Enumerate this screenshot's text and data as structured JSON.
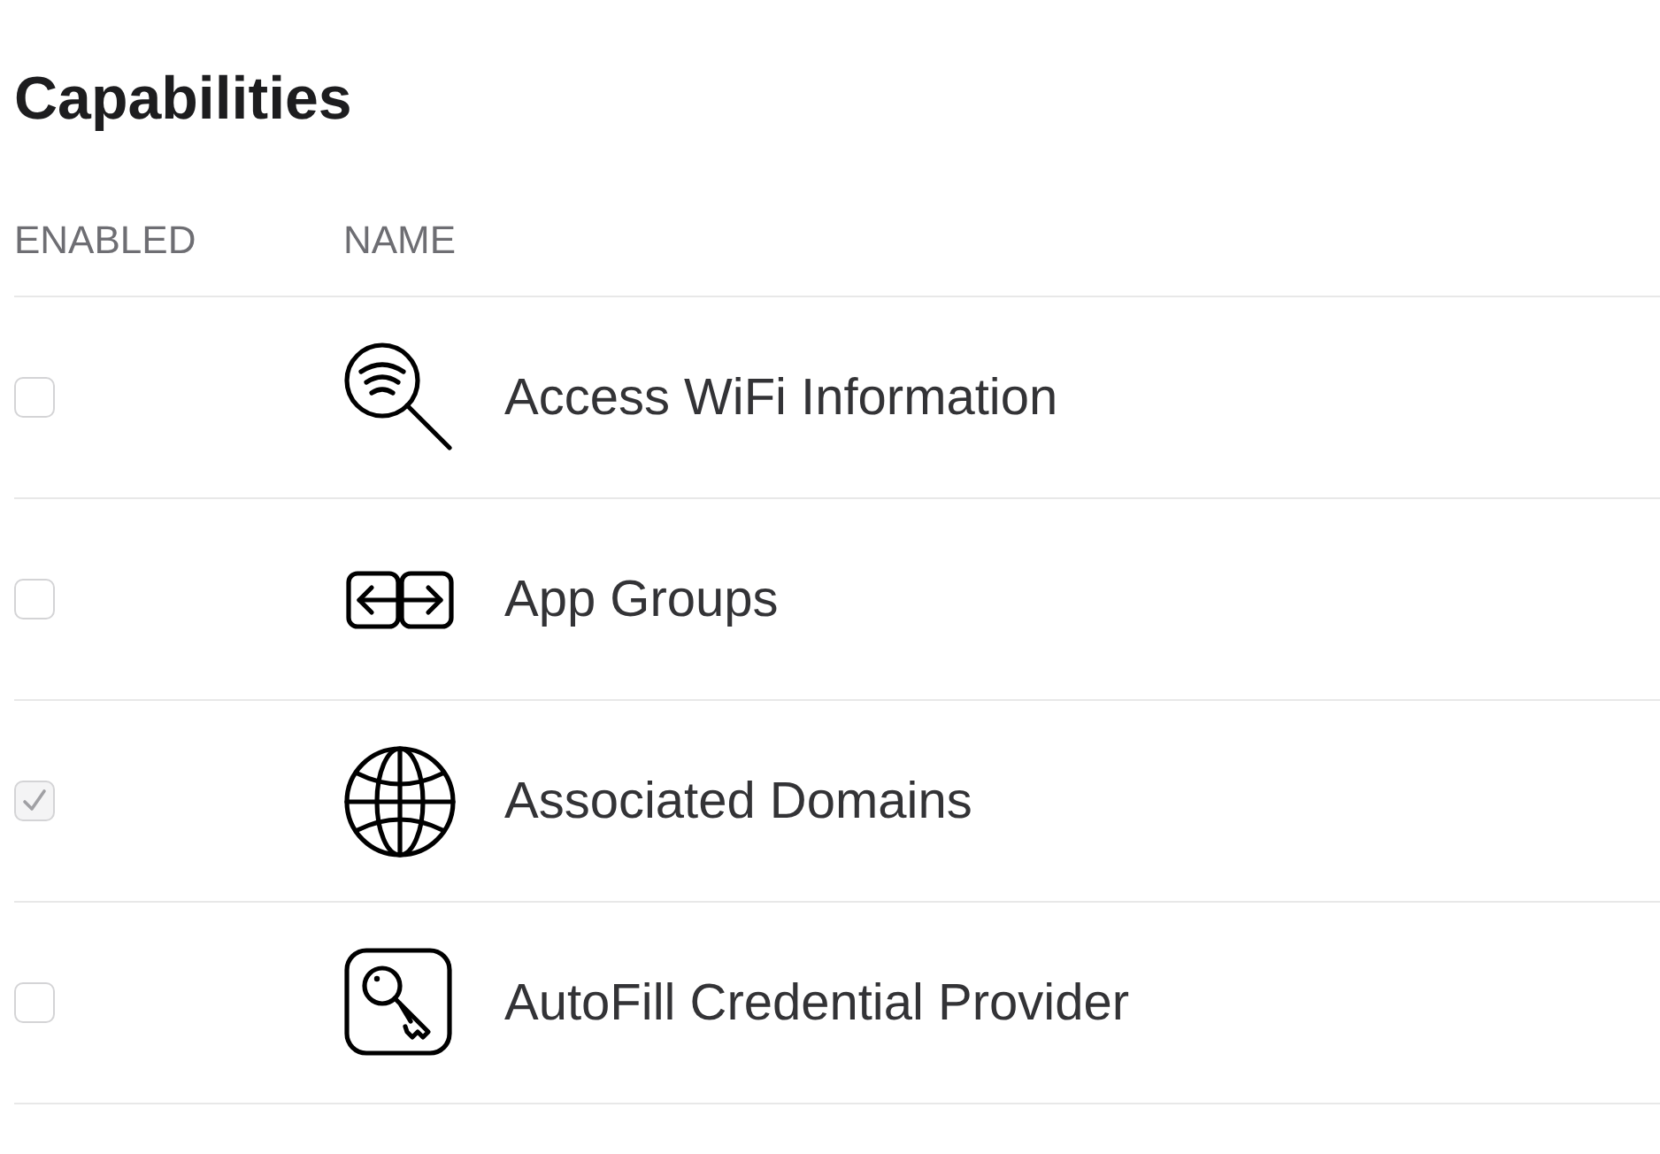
{
  "title": "Capabilities",
  "columns": [
    "ENABLED",
    "NAME"
  ],
  "rows": [
    {
      "name": "Access WiFi Information",
      "checked": false,
      "kind": "wifi"
    },
    {
      "name": "App Groups",
      "checked": false,
      "kind": "groups"
    },
    {
      "name": "Associated Domains",
      "checked": true,
      "kind": "globe"
    },
    {
      "name": "AutoFill Credential Provider",
      "checked": false,
      "kind": "key"
    }
  ]
}
